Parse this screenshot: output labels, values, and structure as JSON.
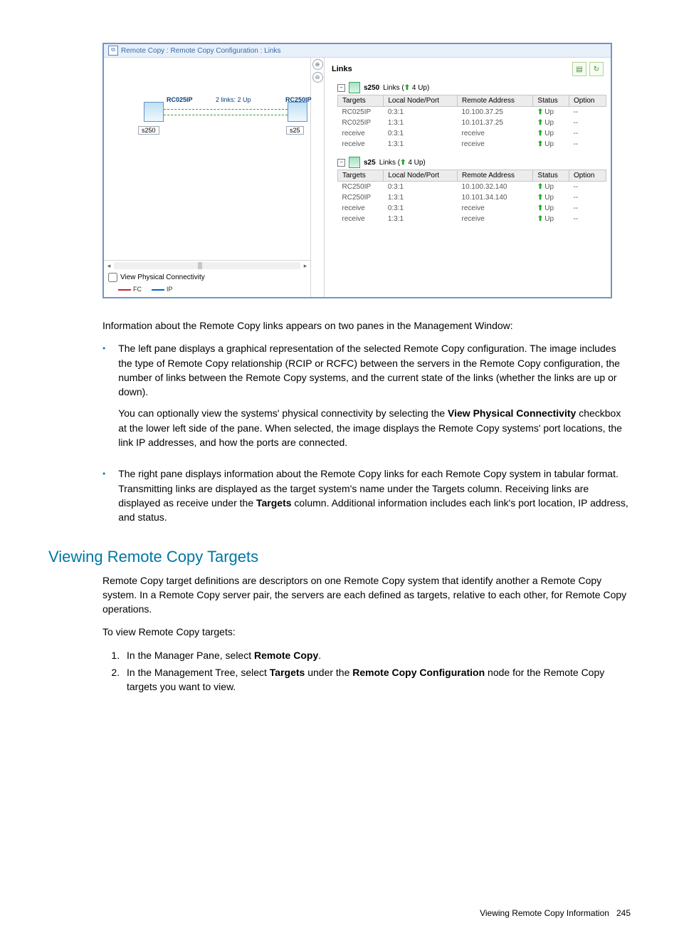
{
  "app": {
    "title": "Remote Copy : Remote Copy Configuration : Links",
    "linksHeading": "Links",
    "diagram": {
      "leftTarget": "RC025IP",
      "rightTarget": "RC250IP",
      "midLabel": "2 links: 2 Up",
      "leftBox": "s250",
      "rightBox": "s25"
    },
    "viewPhysLabel": "View Physical Connectivity",
    "legend": {
      "fc": "FC",
      "ip": "IP"
    },
    "groups": [
      {
        "name": "s250",
        "suffix": "Links (",
        "count": "4 Up)",
        "rows": [
          {
            "targets": "RC025IP",
            "local": "0:3:1",
            "remote": "10.100.37.25",
            "status": "Up",
            "option": "--"
          },
          {
            "targets": "RC025IP",
            "local": "1:3:1",
            "remote": "10.101.37.25",
            "status": "Up",
            "option": "--"
          },
          {
            "targets": "receive",
            "local": "0:3:1",
            "remote": "receive",
            "status": "Up",
            "option": "--"
          },
          {
            "targets": "receive",
            "local": "1:3:1",
            "remote": "receive",
            "status": "Up",
            "option": "--"
          }
        ]
      },
      {
        "name": "s25",
        "suffix": "Links (",
        "count": "4 Up)",
        "rows": [
          {
            "targets": "RC250IP",
            "local": "0:3:1",
            "remote": "10.100.32.140",
            "status": "Up",
            "option": "--"
          },
          {
            "targets": "RC250IP",
            "local": "1:3:1",
            "remote": "10.101.34.140",
            "status": "Up",
            "option": "--"
          },
          {
            "targets": "receive",
            "local": "0:3:1",
            "remote": "receive",
            "status": "Up",
            "option": "--"
          },
          {
            "targets": "receive",
            "local": "1:3:1",
            "remote": "receive",
            "status": "Up",
            "option": "--"
          }
        ]
      }
    ],
    "columns": {
      "targets": "Targets",
      "local": "Local Node/Port",
      "remote": "Remote Address",
      "status": "Status",
      "option": "Option"
    }
  },
  "doc": {
    "intro": "Information about the Remote Copy links appears on two panes in the Management Window:",
    "b1a": "The left pane displays a graphical representation of the selected Remote Copy configuration. The image includes the type of Remote Copy relationship (RCIP or RCFC) between the servers in the Remote Copy configuration, the number of links between the Remote Copy systems, and the current state of the links (whether the links are up or down).",
    "b1b_pre": "You can optionally view the systems' physical connectivity by selecting the ",
    "b1b_bold": "View Physical Connectivity",
    "b1b_post": " checkbox at the lower left side of the pane. When selected, the image displays the Remote Copy systems' port locations, the link IP addresses, and how the ports are connected.",
    "b2_pre": "The right pane displays information about the Remote Copy links for each Remote Copy system in tabular format. Transmitting links are displayed as the target system's name under the Targets column. Receiving links are displayed as receive under the ",
    "b2_bold": "Targets",
    "b2_post": " column. Additional information includes each link's port location, IP address, and status.",
    "section_title": "Viewing Remote Copy Targets",
    "sec_p1": "Remote Copy target definitions are descriptors on one Remote Copy system that identify another a Remote Copy system. In a Remote Copy server pair, the servers are each defined as targets, relative to each other, for Remote Copy operations.",
    "sec_p2": "To view Remote Copy targets:",
    "step1_pre": "In the Manager Pane, select ",
    "step1_bold": "Remote Copy",
    "step1_post": ".",
    "step2_pre": "In the Management Tree, select ",
    "step2_bold1": "Targets",
    "step2_mid": " under the ",
    "step2_bold2": "Remote Copy Configuration",
    "step2_post": " node for the Remote Copy targets you want to view.",
    "footer_label": "Viewing Remote Copy Information",
    "footer_page": "245"
  }
}
